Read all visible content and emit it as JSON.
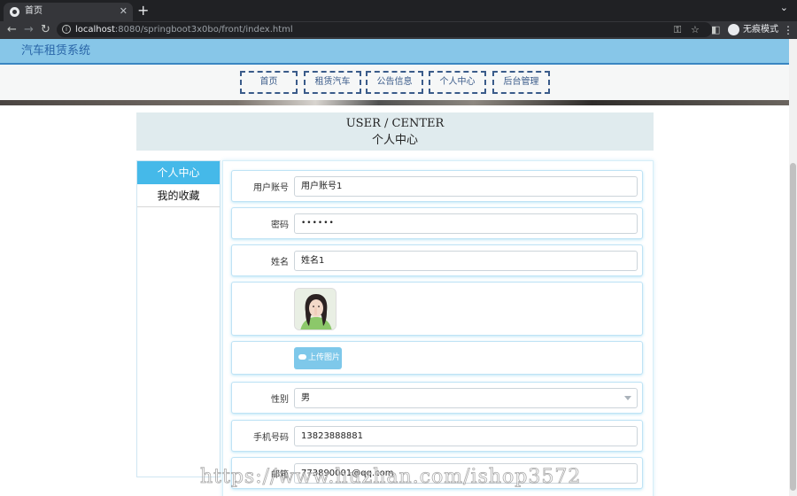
{
  "browser": {
    "tab_title": "首页",
    "tab_close": "✕",
    "new_tab": "+",
    "tab_menu": "⌄",
    "url_host": "localhost",
    "url_rest": ":8080/springboot3x0bo/front/index.html",
    "incognito_label": "无痕模式",
    "icons": [
      "back-icon",
      "forward-icon",
      "reload-icon",
      "info-icon",
      "key-icon",
      "star-icon",
      "sidepanel-icon",
      "incognito-icon",
      "menu-icon"
    ]
  },
  "site": {
    "title": "汽车租赁系统",
    "nav": [
      "首页",
      "租赁汽车",
      "公告信息",
      "个人中心",
      "后台管理"
    ]
  },
  "page_title": {
    "en": "USER / CENTER",
    "cn": "个人中心"
  },
  "side_menu": {
    "items": [
      "个人中心",
      "我的收藏"
    ],
    "active": "个人中心"
  },
  "form": {
    "username_label": "用户账号",
    "username_value": "用户账号1",
    "password_label": "密码",
    "password_value": "••••••",
    "name_label": "姓名",
    "name_value": "姓名1",
    "upload_label": "上传图片",
    "gender_label": "性别",
    "gender_value": "男",
    "phone_label": "手机号码",
    "phone_value": "13823888881",
    "email_label": "邮箱",
    "email_value": "773890001@qq.com"
  },
  "watermark": "https://www.huzhan.com/ishop3572",
  "colors": {
    "header_bg": "#87c6e8",
    "accent": "#45b9e9",
    "nav_border": "#3a5b8a"
  }
}
